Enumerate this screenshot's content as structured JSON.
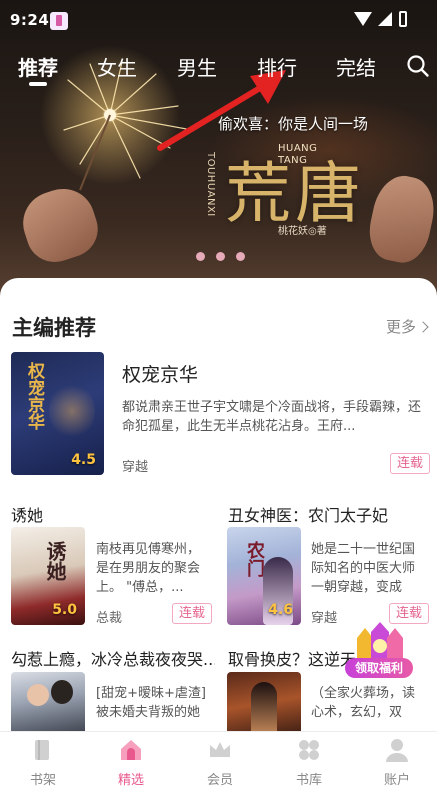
{
  "status_bar": {
    "time": "9:24"
  },
  "top_tabs": [
    {
      "label": "推荐",
      "active": true
    },
    {
      "label": "女生",
      "active": false
    },
    {
      "label": "男生",
      "active": false
    },
    {
      "label": "排行",
      "active": false
    },
    {
      "label": "完结",
      "active": false
    }
  ],
  "banner": {
    "subtitle": "偷欢喜：你是人间一场",
    "pinyin": "HUANG TANG",
    "pinyin_vertical": "TOUHUANXI",
    "title": "荒唐",
    "author": "桃花妖◎著",
    "page_count": 3
  },
  "editor_picks": {
    "title": "主编推荐",
    "more_label": "更多"
  },
  "featured_book": {
    "title": "权宠京华",
    "description": "都说肃亲王世子宇文啸是个冷面战将，手段霸辣，还命犯孤星，此生无半点桃花沾身。王府...",
    "genre": "穿越",
    "status": "连载",
    "rating": "4.5",
    "cover_text": "权宠京华"
  },
  "grid_books": [
    {
      "title": "诱她",
      "description": "南枝再见傅寒州，是在男朋友的聚会上。 \"傅总，...",
      "genre": "总裁",
      "status": "连载",
      "rating": "5.0",
      "cover_text": "诱她"
    },
    {
      "title": "丑女神医：农门太子妃",
      "description": "她是二十一世纪国际知名的中医大师一朝穿越，变成了...",
      "genre": "穿越",
      "status": "连载",
      "rating": "4.6",
      "cover_text": "农门"
    },
    {
      "title": "勾惹上瘾，冰冷总裁夜夜哭...",
      "description": "[甜宠+暧昧+虐渣]被未婚夫背叛的她半夜敲响了传闻中..."
    },
    {
      "title": "取骨换皮？这逆天...",
      "description": "（全家火葬场，读心术，玄幻，双洁，打脸爽文）云..."
    }
  ],
  "welfare": {
    "label": "领取福利"
  },
  "bottom_nav": [
    {
      "label": "书架",
      "icon": "bookshelf-icon",
      "active": false
    },
    {
      "label": "精选",
      "icon": "home-icon",
      "active": true
    },
    {
      "label": "会员",
      "icon": "crown-icon",
      "active": false
    },
    {
      "label": "书库",
      "icon": "library-icon",
      "active": false
    },
    {
      "label": "账户",
      "icon": "user-icon",
      "active": false
    }
  ],
  "colors": {
    "accent": "#e85a8e",
    "rating": "#ffc340",
    "banner_title": "#d8b46a"
  }
}
